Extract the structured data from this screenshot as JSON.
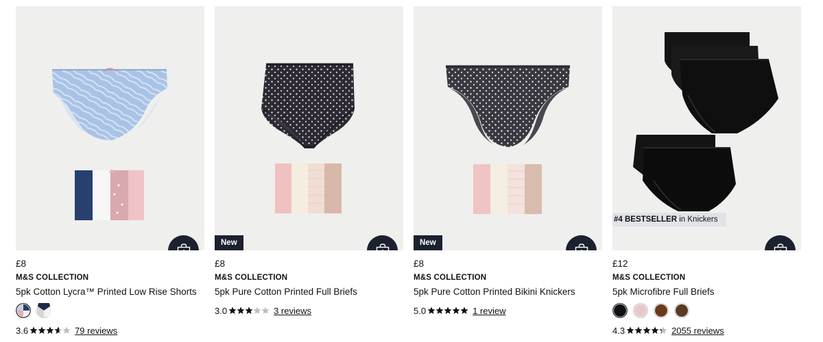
{
  "products": [
    {
      "price": "£8",
      "brand": "M&S COLLECTION",
      "title": "5pk Cotton Lycra™ Printed Low Rise Shorts",
      "badge": "",
      "rating": "3.6",
      "rating_value": 3.6,
      "reviews": "79 reviews",
      "swatches": [
        "pink-white-mix",
        "navy-white-mix"
      ]
    },
    {
      "price": "£8",
      "brand": "M&S COLLECTION",
      "title": "5pk Pure Cotton Printed Full Briefs",
      "badge": "New",
      "rating": "3.0",
      "rating_value": 3.0,
      "reviews": "3 reviews",
      "swatches": []
    },
    {
      "price": "£8",
      "brand": "M&S COLLECTION",
      "title": "5pk Pure Cotton Printed Bikini Knickers",
      "badge": "New",
      "rating": "5.0",
      "rating_value": 5.0,
      "reviews": "1 review",
      "swatches": []
    },
    {
      "price": "£12",
      "brand": "M&S COLLECTION",
      "title": "5pk Microfibre Full Briefs",
      "badge": "",
      "bestseller_rank": "#4 BESTSELLER",
      "bestseller_suffix": " in Knickers",
      "rating": "4.3",
      "rating_value": 4.3,
      "reviews": "2055 reviews",
      "swatches": [
        "#111111",
        "#e8c9c9",
        "#6b3a1c",
        "#5a3a22"
      ]
    }
  ],
  "icons": {
    "add_to_bag": "shopping-bag-plus-icon",
    "star": "star-icon"
  },
  "colors": {
    "button_bg": "#1c2130",
    "card_bg": "#efefed",
    "star": "#111111",
    "star_empty": "#bdbdbd"
  }
}
